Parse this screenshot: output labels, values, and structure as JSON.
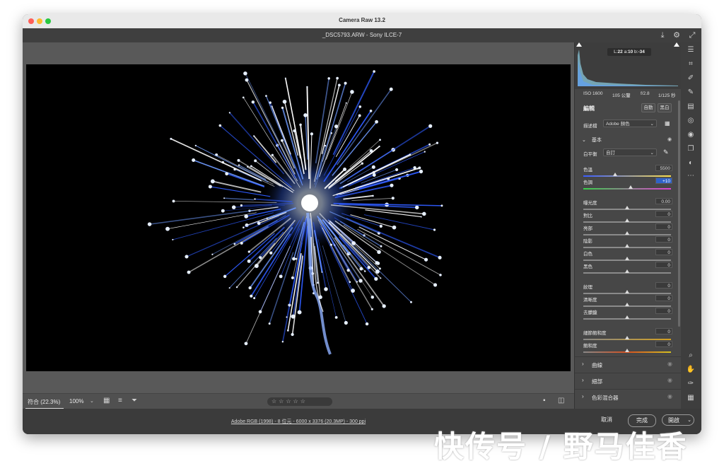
{
  "window": {
    "title": "Camera Raw 13.2"
  },
  "file": {
    "name": "_DSC5793.ARW  -  Sony ILCE-7"
  },
  "histogram": {
    "lab": {
      "l_label": "L:",
      "l": "22",
      "a_label": "a:",
      "a": "10",
      "b_label": "b:",
      "b": "-34"
    }
  },
  "camera": {
    "iso": "ISO 1600",
    "focal": "105 公釐",
    "aperture": "f/2.8",
    "shutter": "1/125 秒"
  },
  "edit": {
    "title": "編輯",
    "auto": "自動",
    "bw": "黑白",
    "profile_label": "描述檔",
    "profile_value": "Adobe 顏色"
  },
  "basic": {
    "title": "基本",
    "wb_label": "白平衡",
    "wb_value": "自訂",
    "sliders": [
      {
        "label": "色溫",
        "value": "5500",
        "pos": 0.36
      },
      {
        "label": "色調",
        "value": "+10",
        "pos": 0.54
      },
      {
        "label": "曝光度",
        "value": "0.00",
        "pos": 0.5
      },
      {
        "label": "對比",
        "value": "0",
        "pos": 0.5
      },
      {
        "label": "亮部",
        "value": "0",
        "pos": 0.5
      },
      {
        "label": "陰影",
        "value": "0",
        "pos": 0.5
      },
      {
        "label": "白色",
        "value": "0",
        "pos": 0.5
      },
      {
        "label": "黑色",
        "value": "0",
        "pos": 0.5
      },
      {
        "label": "紋理",
        "value": "0",
        "pos": 0.5
      },
      {
        "label": "清晰度",
        "value": "0",
        "pos": 0.5
      },
      {
        "label": "去朦朧",
        "value": "0",
        "pos": 0.5
      },
      {
        "label": "細節飽和度",
        "value": "0",
        "pos": 0.5
      },
      {
        "label": "飽和度",
        "value": "0",
        "pos": 0.5
      }
    ]
  },
  "sections": [
    "曲線",
    "細部",
    "色彩混合器"
  ],
  "viewer": {
    "fit": "符合 (22.3%)",
    "zoom": "100%",
    "stars": "☆☆☆☆☆"
  },
  "status": {
    "info": "Adobe RGB (1998) - 8 位元 - 6000 x 3376 (20.3MP) - 300 ppi"
  },
  "buttons": {
    "cancel": "取消",
    "done": "完成",
    "open": "開啟"
  },
  "watermark": "快传号 / 野马佳香"
}
